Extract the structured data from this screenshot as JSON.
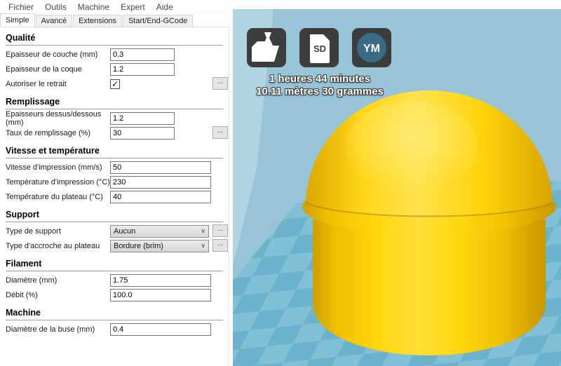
{
  "menu": {
    "items": [
      "Fichier",
      "Outils",
      "Machine",
      "Expert",
      "Aide"
    ]
  },
  "tabs": {
    "items": [
      "Simple",
      "Avancé",
      "Extensions",
      "Start/End-GCode"
    ],
    "selected": "Simple"
  },
  "icons": {
    "check": "✓",
    "chevron": "∨",
    "more": "...",
    "sd_label": "SD",
    "ym_label": "YM"
  },
  "panel": {
    "sections": [
      {
        "title": "Qualité",
        "rows": [
          {
            "label": "Epaisseur de couche (mm)",
            "type": "input",
            "value": "0.3"
          },
          {
            "label": "Epaisseur de la coque",
            "type": "input",
            "value": "1.2"
          },
          {
            "label": "Autoriser le retrait",
            "type": "checkbox",
            "checked": true
          }
        ]
      },
      {
        "title": "Remplissage",
        "rows": [
          {
            "label": "Epaisseurs dessus/dessous (mm)",
            "type": "input",
            "value": "1.2"
          },
          {
            "label": "Taux de remplissage (%)",
            "type": "input",
            "value": "30"
          }
        ]
      },
      {
        "title": "Vitesse et température",
        "rows": [
          {
            "label": "Vitesse d'impression (mm/s)",
            "type": "input",
            "value": "50"
          },
          {
            "label": "Température d'impression (°C)",
            "type": "input",
            "value": "230"
          },
          {
            "label": "Température du plateau (°C)",
            "type": "input",
            "value": "40"
          }
        ]
      },
      {
        "title": "Support",
        "rows": [
          {
            "label": "Type de support",
            "type": "select",
            "value": "Aucun"
          },
          {
            "label": "Type d'accroche au plateau",
            "type": "select",
            "value": "Bordure (brim)"
          }
        ]
      },
      {
        "title": "Filament",
        "rows": [
          {
            "label": "Diamètre (mm)",
            "type": "input",
            "value": "1.75"
          },
          {
            "label": "Débit (%)",
            "type": "input",
            "value": "100.0"
          }
        ]
      },
      {
        "title": "Machine",
        "rows": [
          {
            "label": "Diamètre de la buse (mm)",
            "type": "input",
            "value": "0.4"
          }
        ]
      }
    ]
  },
  "viewport": {
    "time_estimate": "1 heures 44 minutes",
    "material_estimate": "10.11 mètres 30 grammes"
  },
  "colors": {
    "background_blue": "#98c4d7",
    "wall_blue": "#b0d4e2",
    "checker_light": "#82c0d8",
    "checker_dark": "#6bb2cd",
    "model_yellow": "#ffd60e",
    "model_shadow": "#cf9e00",
    "icon_bg": "#3d3d3d",
    "ym_circle": "#3a6a85"
  }
}
